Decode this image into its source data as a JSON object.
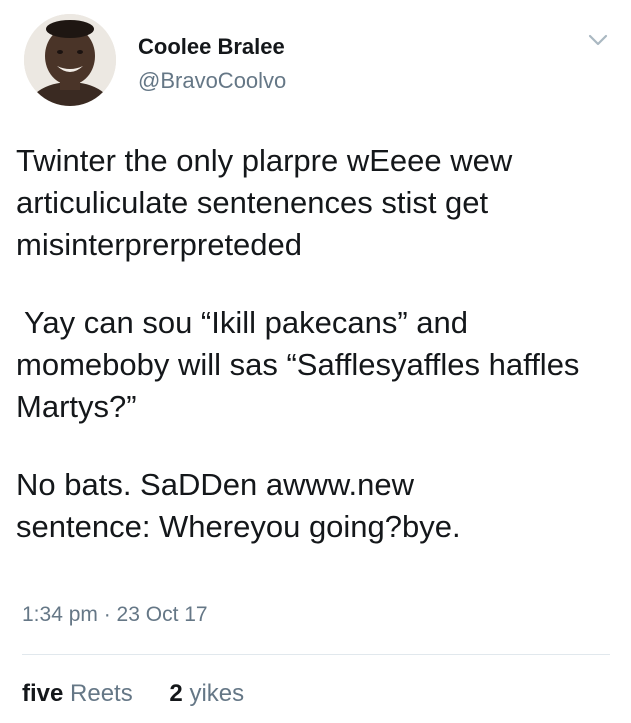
{
  "user": {
    "display_name": "Coolee Bralee",
    "handle": "@BravoCoolvo"
  },
  "tweet": {
    "paragraphs": [
      {
        "lines": [
          "Twinter the only plarpre wEeee wew",
          "articuliculate sentenences stist get",
          "misinterprerpreteded"
        ]
      },
      {
        "lines": [
          "Yay can sou “Ikill pakecans” and",
          "momeboby will sas “Safflesyaffles haffles",
          "Martys?”"
        ]
      },
      {
        "lines": [
          "No bats. SaDDen awww.new",
          "sentence: Whereyou going?bye."
        ]
      }
    ],
    "timestamp": "1:34 pm · 23 Oct 17"
  },
  "stats": {
    "retweets_count": "five",
    "retweets_label": "Reets",
    "likes_count": "2",
    "likes_label": "yikes"
  },
  "icons": {
    "menu": "chevron-down-icon",
    "avatar": "avatar"
  },
  "colors": {
    "text": "#14171a",
    "secondary_text": "#657786",
    "divider": "#e1e8ed"
  }
}
